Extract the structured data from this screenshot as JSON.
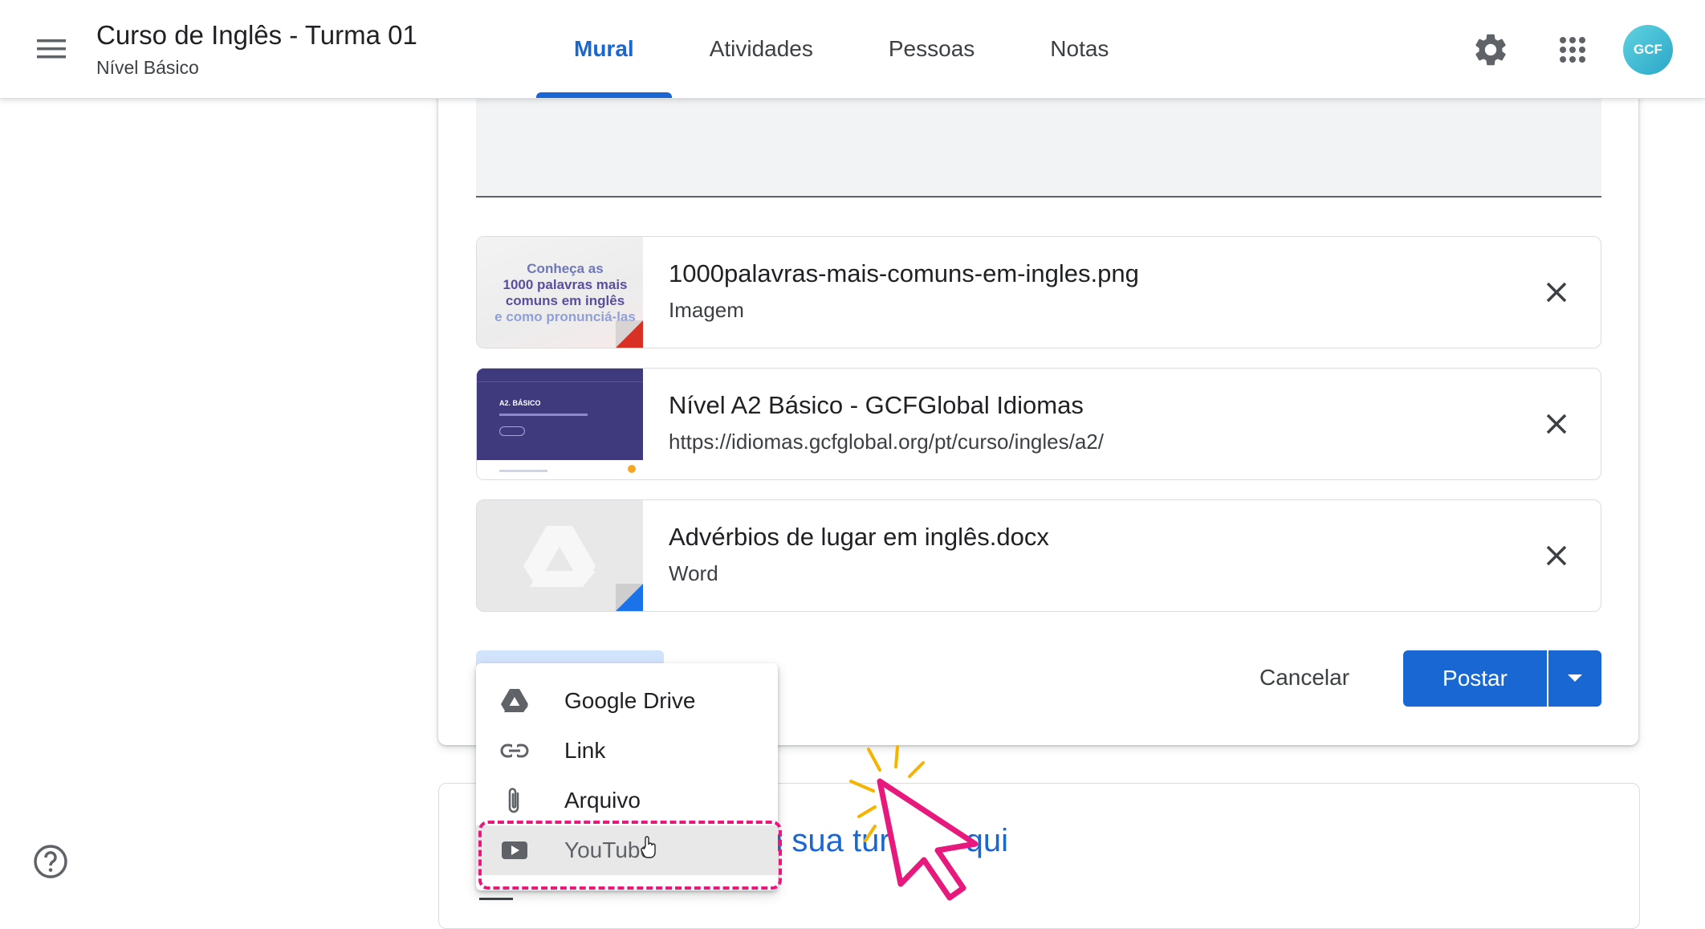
{
  "header": {
    "title": "Curso de Inglês - Turma 01",
    "subtitle": "Nível Básico",
    "tabs": [
      {
        "label": "Mural",
        "active": true
      },
      {
        "label": "Atividades",
        "active": false
      },
      {
        "label": "Pessoas",
        "active": false
      },
      {
        "label": "Notas",
        "active": false
      }
    ],
    "icons": [
      "menu-icon",
      "gear-icon",
      "apps-grid-icon",
      "avatar"
    ],
    "avatar_text": "GCF"
  },
  "attachments": [
    {
      "title": "1000palavras-mais-comuns-em-ingles.png",
      "subtitle": "Imagem",
      "type": "image",
      "thumb_text": [
        "Conheça as",
        "1000 palavras mais",
        "comuns em inglês",
        "e como pronunciá-las"
      ],
      "corner_color": "#d93025"
    },
    {
      "title": "Nível A2 Básico - GCFGlobal Idiomas",
      "subtitle": "https://idiomas.gcfglobal.org/pt/curso/ingles/a2/",
      "type": "link",
      "thumb_text": [
        "A2. BÁSICO"
      ]
    },
    {
      "title": "Advérbios de lugar em inglês.docx",
      "subtitle": "Word",
      "type": "docx",
      "corner_color": "#1a73e8"
    }
  ],
  "actions": {
    "cancel_label": "Cancelar",
    "post_label": "Postar"
  },
  "add_menu": {
    "items": [
      {
        "label": "Google Drive",
        "icon": "google-drive-icon"
      },
      {
        "label": "Link",
        "icon": "link-icon"
      },
      {
        "label": "Arquivo",
        "icon": "paperclip-icon"
      },
      {
        "label": "YouTube",
        "icon": "youtube-icon",
        "highlighted": true
      }
    ]
  },
  "background_card": {
    "text_left": "n sua tur",
    "text_right": "qui"
  },
  "colors": {
    "accent": "#1967d2",
    "highlight": "#e8197c",
    "annotation_rays": "#f4b400"
  }
}
